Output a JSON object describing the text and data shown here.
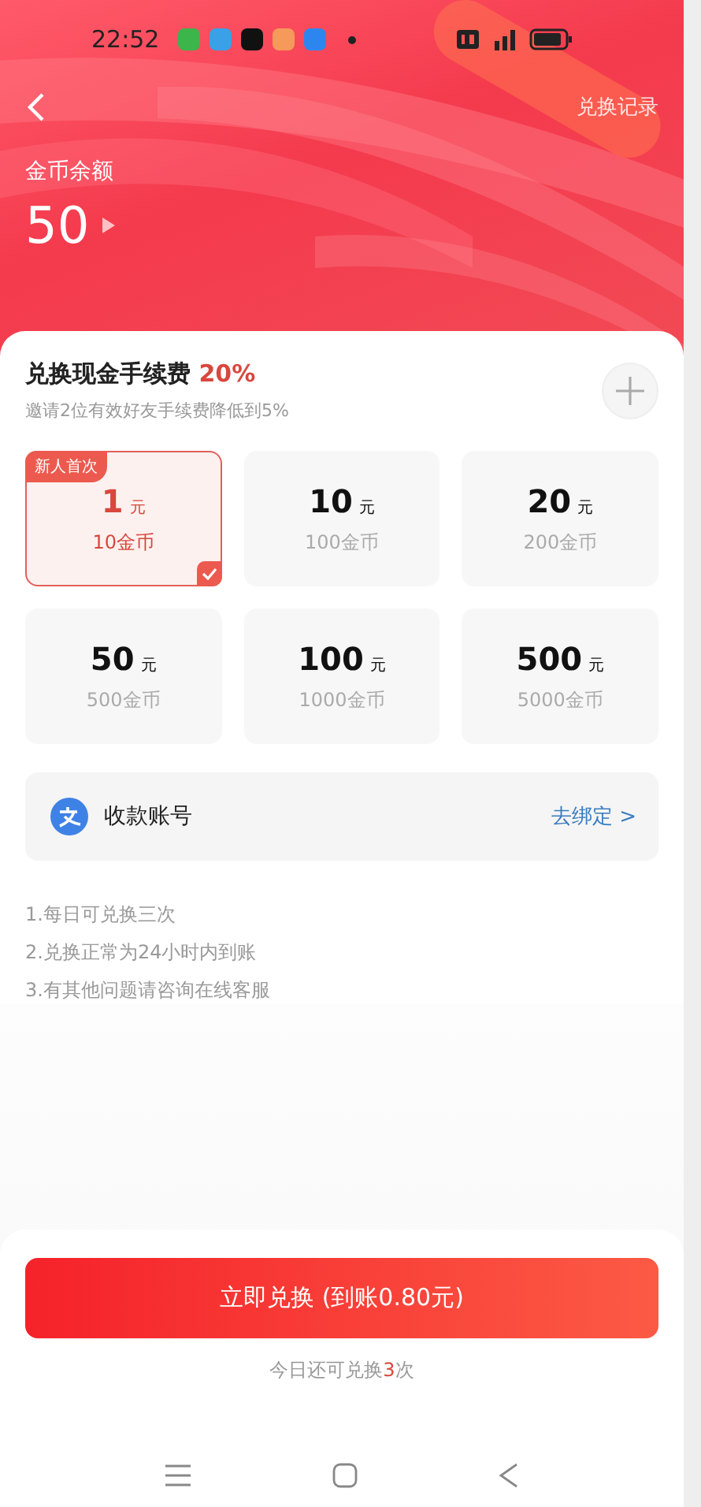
{
  "status_bar": {
    "time": "22:52"
  },
  "header": {
    "records_link": "兑换记录",
    "balance_label": "金币余额",
    "balance": "50"
  },
  "fee": {
    "title": "兑换现金手续费",
    "rate": "20%",
    "hint": "邀请2位有效好友手续费降低到5%"
  },
  "options": [
    {
      "amount": "1",
      "unit": "元",
      "coins": "10金币",
      "selected": true,
      "badge": "新人首次"
    },
    {
      "amount": "10",
      "unit": "元",
      "coins": "100金币",
      "selected": false
    },
    {
      "amount": "20",
      "unit": "元",
      "coins": "200金币",
      "selected": false
    },
    {
      "amount": "50",
      "unit": "元",
      "coins": "500金币",
      "selected": false
    },
    {
      "amount": "100",
      "unit": "元",
      "coins": "1000金币",
      "selected": false
    },
    {
      "amount": "500",
      "unit": "元",
      "coins": "5000金币",
      "selected": false
    }
  ],
  "account": {
    "label": "收款账号",
    "action": "去绑定 >"
  },
  "rules": [
    "1.每日可兑换三次",
    "2.兑换正常为24小时内到账",
    "3.有其他问题请咨询在线客服"
  ],
  "submit": {
    "label": "立即兑换 (到账0.80元)"
  },
  "remaining": {
    "before": "今日还可兑换",
    "count": "3",
    "after": "次"
  }
}
